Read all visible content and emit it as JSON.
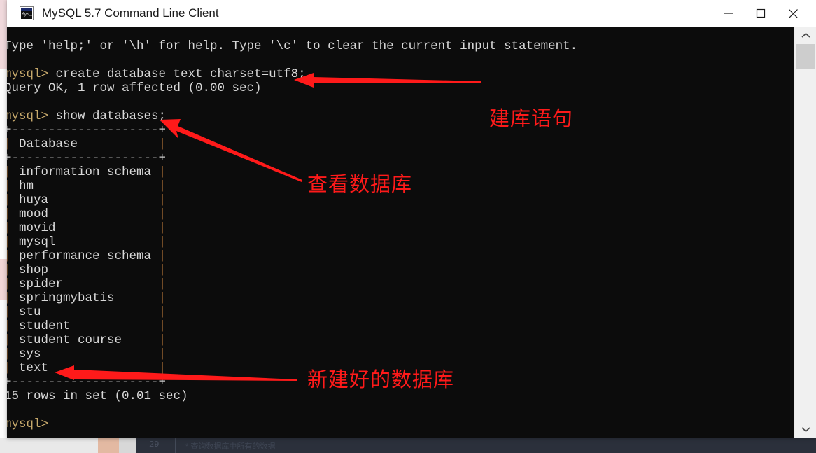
{
  "window": {
    "title": "MySQL 5.7 Command Line Client",
    "icon_name": "mysql-console-icon",
    "icon_glyph": "Mys_",
    "controls": {
      "minimize": "—",
      "maximize": "□",
      "close": "✕"
    }
  },
  "terminal": {
    "lines": [
      "Type 'help;' or '\\h' for help. Type '\\c' to clear the current input statement.",
      "",
      "mysql> create database text charset=utf8;",
      "Query OK, 1 row affected (0.00 sec)",
      "",
      "mysql> show databases;",
      "+--------------------+",
      "| Database           |",
      "+--------------------+",
      "| information_schema |",
      "| hm                 |",
      "| huya               |",
      "| mood               |",
      "| movid              |",
      "| mysql              |",
      "| performance_schema |",
      "| shop               |",
      "| spider             |",
      "| springmybatis      |",
      "| stu                |",
      "| student            |",
      "| student_course     |",
      "| sys                |",
      "| text               |",
      "+--------------------+",
      "15 rows in set (0.01 sec)",
      "",
      "mysql> "
    ],
    "prompt": "mysql>",
    "help_line": "Type 'help;' or '\\h' for help. Type '\\c' to clear the current input statement.",
    "create_statement": "create database text charset=utf8;",
    "create_result": "Query OK, 1 row affected (0.00 sec)",
    "show_statement": "show databases;",
    "column_header": "Database",
    "databases": [
      "information_schema",
      "hm",
      "huya",
      "mood",
      "movid",
      "mysql",
      "performance_schema",
      "shop",
      "spider",
      "springmybatis",
      "stu",
      "student",
      "student_course",
      "sys",
      "text"
    ],
    "row_count_text": "15 rows in set (0.01 sec)",
    "colors": {
      "background": "#0c0c0c",
      "text": "#d8d8d8",
      "prompt": "#c7a96b",
      "table_border": "#c9c9c9"
    }
  },
  "annotations": {
    "color": "#ff1a1a",
    "items": [
      {
        "label": "建库语句"
      },
      {
        "label": "查看数据库"
      },
      {
        "label": "新建好的数据库"
      }
    ]
  },
  "scrollbar": {
    "up_arrow": "⌃",
    "down_arrow": "⌄"
  },
  "background": {
    "ide_line_number": "29",
    "ide_text": "* 查询数据库中所有的数据"
  }
}
